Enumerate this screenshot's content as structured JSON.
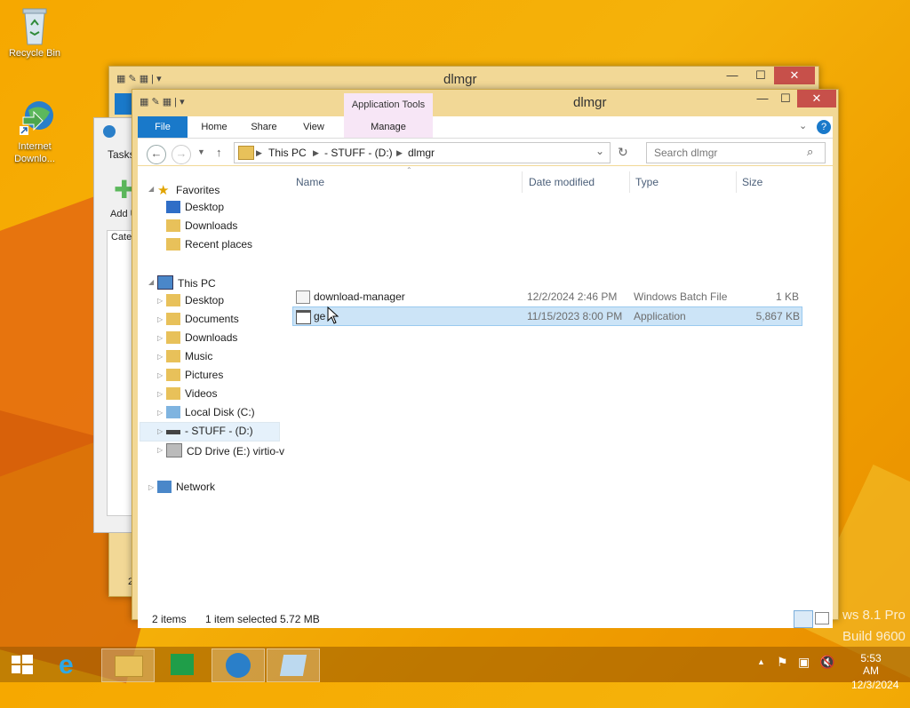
{
  "desktop": {
    "icons": [
      {
        "label": "Recycle Bin",
        "icon": "recycle-bin-icon"
      },
      {
        "label": "Internet Downlo...",
        "icon": "internet-download-manager-icon"
      }
    ],
    "watermark_line1": "ws 8.1 Pro",
    "watermark_line2": "Build 9600"
  },
  "back_window": {
    "title": "dlmgr",
    "inner_partial": {
      "tasks_label": "Tasks",
      "add_label": "Add U",
      "cate_label": "Cate",
      "counter": "2"
    }
  },
  "explorer": {
    "title": "dlmgr",
    "contextual_tab_group": "Application Tools",
    "tabs": [
      "File",
      "Home",
      "Share",
      "View",
      "Manage"
    ],
    "breadcrumb": [
      "This PC",
      "- STUFF - (D:)",
      "dlmgr"
    ],
    "search_placeholder": "Search dlmgr",
    "nav": {
      "favorites": "Favorites",
      "favorites_items": [
        "Desktop",
        "Downloads",
        "Recent places"
      ],
      "this_pc": "This PC",
      "this_pc_items": [
        "Desktop",
        "Documents",
        "Downloads",
        "Music",
        "Pictures",
        "Videos",
        "Local Disk (C:)",
        "- STUFF - (D:)",
        "CD Drive (E:) virtio-v"
      ],
      "network": "Network"
    },
    "columns": [
      "Name",
      "Date modified",
      "Type",
      "Size"
    ],
    "files": [
      {
        "name": "download-manager",
        "date": "12/2/2024 2:46 PM",
        "type": "Windows Batch File",
        "size": "1 KB",
        "icon": "batch-file-icon",
        "selected": false
      },
      {
        "name": "ge",
        "date": "11/15/2023 8:00 PM",
        "type": "Application",
        "size": "5,867 KB",
        "icon": "application-icon",
        "selected": true
      }
    ],
    "status": {
      "count": "2 items",
      "selection": "1 item selected  5.72 MB"
    }
  },
  "taskbar": {
    "time": "5:53 AM",
    "date": "12/3/2024"
  },
  "colors": {
    "accent": "#1979ca",
    "selection": "#cce4f7",
    "close": "#c7504a"
  }
}
